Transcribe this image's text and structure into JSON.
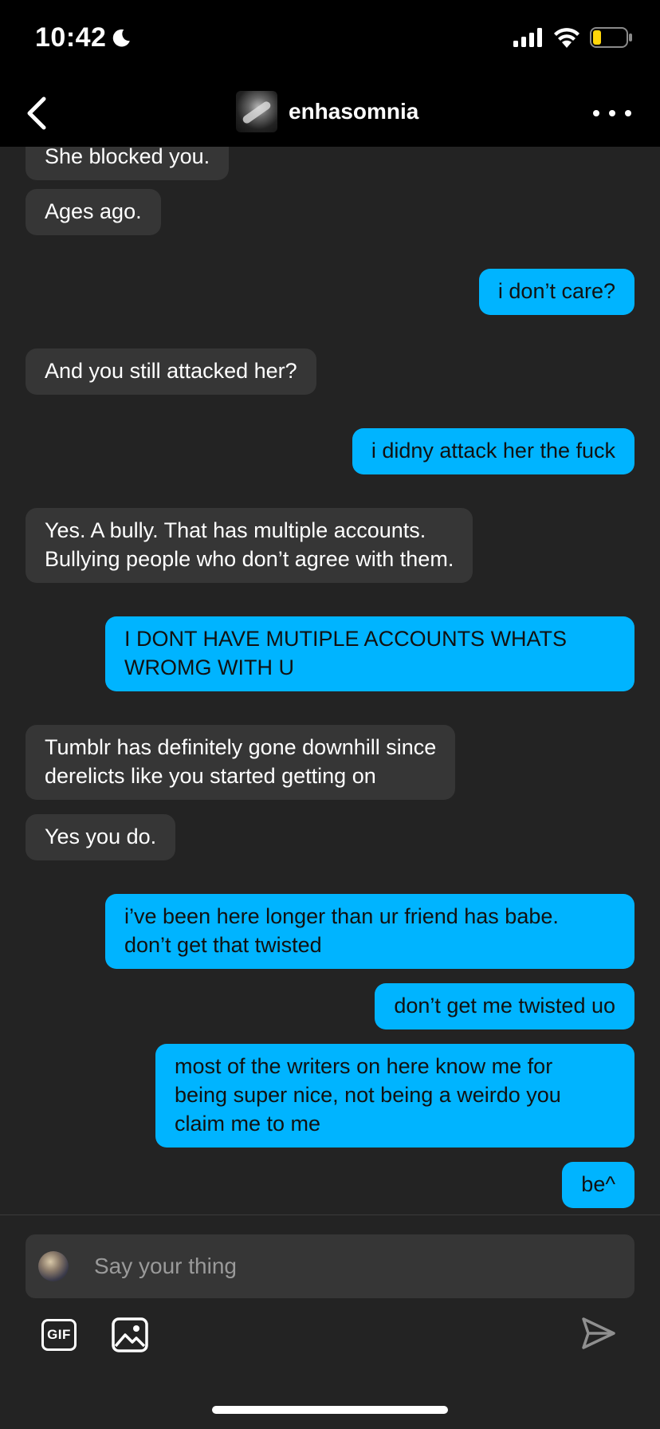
{
  "status_bar": {
    "time": "10:42",
    "moon_icon": "moon-icon",
    "signal_icon": "cellular-signal-icon",
    "wifi_icon": "wifi-icon",
    "battery_icon": "battery-low-icon",
    "battery_color": "#ffd60a"
  },
  "header": {
    "back_icon": "chevron-left-icon",
    "username": "enhasomnia",
    "more_icon": "more-horizontal-icon"
  },
  "colors": {
    "sent_bubble": "#00b4ff",
    "received_bubble": "#363636",
    "background": "#232323"
  },
  "messages": [
    {
      "from": "them",
      "text": "She blocked you."
    },
    {
      "from": "them",
      "text": "Ages ago."
    },
    {
      "from": "me",
      "text": "i don’t care?"
    },
    {
      "from": "them",
      "text": "And you still attacked her?"
    },
    {
      "from": "me",
      "text": "i didny attack her the fuck"
    },
    {
      "from": "them",
      "lines": [
        "Yes. A bully. That has multiple accounts.",
        "Bullying people who don’t agree with them."
      ]
    },
    {
      "from": "me",
      "lines": [
        "I DONT HAVE MUTIPLE ACCOUNTS WHATS",
        "WROMG WITH U"
      ]
    },
    {
      "from": "them",
      "lines": [
        "Tumblr has definitely gone downhill since",
        "derelicts like you started getting on"
      ]
    },
    {
      "from": "them",
      "text": "Yes you do."
    },
    {
      "from": "me",
      "lines": [
        "i’ve been here longer than ur friend has babe.",
        "don’t get that twisted"
      ]
    },
    {
      "from": "me",
      "text": "don’t get me twisted uo"
    },
    {
      "from": "me",
      "lines": [
        "most of the writers on here know me for",
        "being super nice, not being a weirdo you",
        "claim me to me"
      ]
    },
    {
      "from": "me",
      "text": "be^"
    }
  ],
  "composer": {
    "placeholder": "Say your thing",
    "gif_label": "GIF",
    "image_icon": "image-icon",
    "send_icon": "send-icon"
  }
}
